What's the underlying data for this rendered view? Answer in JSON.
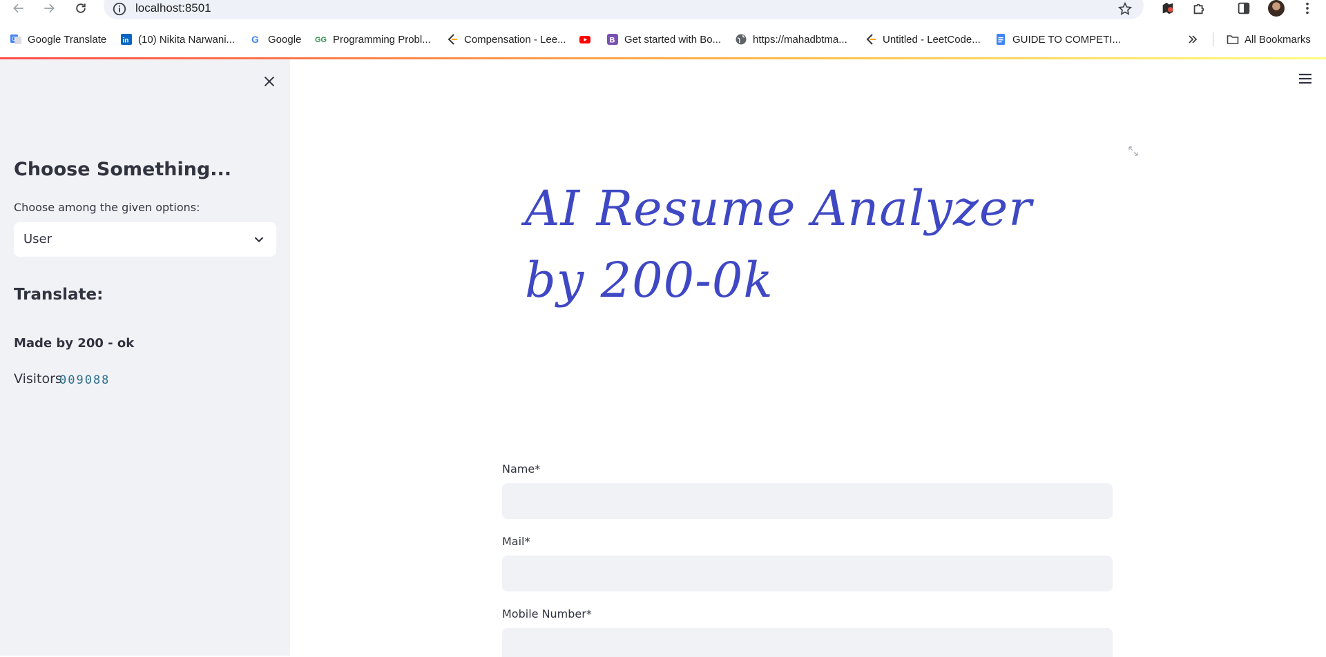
{
  "browser": {
    "url": "localhost:8501",
    "bookmarks": [
      {
        "label": "Google Translate",
        "icon": "google-translate-icon"
      },
      {
        "label": "(10) Nikita Narwani...",
        "icon": "linkedin-icon"
      },
      {
        "label": "Google",
        "icon": "google-icon"
      },
      {
        "label": "Programming Probl...",
        "icon": "geeksforgeeks-icon"
      },
      {
        "label": "Compensation - Lee...",
        "icon": "leetcode-icon"
      },
      {
        "label": "",
        "icon": "youtube-icon"
      },
      {
        "label": "Get started with Bo...",
        "icon": "bootstrap-icon"
      },
      {
        "label": "https://mahadbtma...",
        "icon": "globe-icon"
      },
      {
        "label": "Untitled - LeetCode...",
        "icon": "leetcode-icon"
      },
      {
        "label": "GUIDE TO COMPETI...",
        "icon": "google-docs-icon"
      }
    ],
    "all_bookmarks_label": "All Bookmarks"
  },
  "sidebar": {
    "title": "Choose Something...",
    "select_label": "Choose among the given options:",
    "select_value": "User",
    "translate_heading": "Translate:",
    "made_by": "Made by 200 - ok",
    "visitors_label": "Visitors",
    "visitors_count": "009088"
  },
  "main": {
    "hero_title_line1": "AI Resume Analyzer",
    "hero_title_line2": "by 200-0k",
    "form": {
      "name_label": "Name*",
      "name_value": "",
      "mail_label": "Mail*",
      "mail_value": "",
      "mobile_label": "Mobile Number*",
      "mobile_value": ""
    }
  },
  "colors": {
    "accent_red": "#ff4b4b",
    "hero_blue": "#3f48c4",
    "sidebar_bg": "#f0f2f6"
  }
}
